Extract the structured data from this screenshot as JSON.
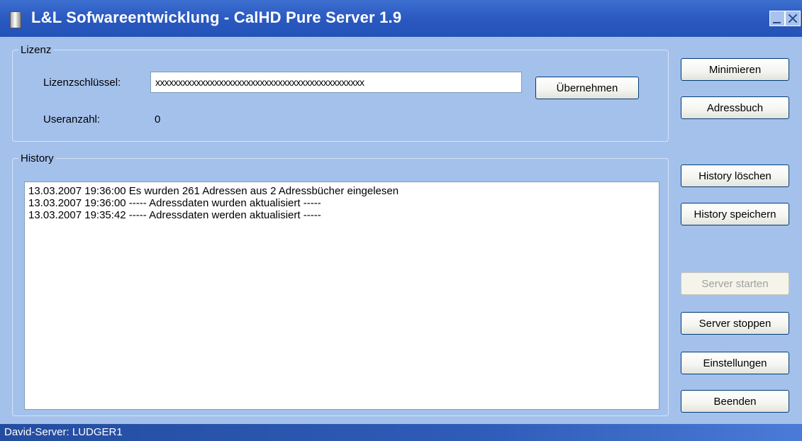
{
  "window": {
    "title": "L&L Sofwareentwicklung - CalHD Pure Server 1.9"
  },
  "lizenz": {
    "legend": "Lizenz",
    "key_label": "Lizenzschlüssel:",
    "key_value": "xxxxxxxxxxxxxxxxxxxxxxxxxxxxxxxxxxxxxxxxxxxxxx",
    "apply_button": "Übernehmen",
    "users_label": "Useranzahl:",
    "users_value": "0"
  },
  "history": {
    "legend": "History",
    "entries": [
      "13.03.2007 19:36:00 Es wurden 261 Adressen aus 2 Adressbücher eingelesen",
      "13.03.2007 19:36:00 ----- Adressdaten wurden aktualisiert -----",
      "13.03.2007 19:35:42 ----- Adressdaten werden aktualisiert -----"
    ]
  },
  "buttons": {
    "minimize": "Minimieren",
    "address_book": "Adressbuch",
    "history_clear": "History löschen",
    "history_save": "History speichern",
    "server_start": "Server starten",
    "server_stop": "Server stoppen",
    "settings": "Einstellungen",
    "exit": "Beenden"
  },
  "status": {
    "text": "David-Server: LUDGER1"
  },
  "icons": {
    "app": "server-icon",
    "minimize": "minimize-icon",
    "close": "close-icon"
  },
  "colors": {
    "title_bar": "#2a59c0",
    "window_bg": "#a4c1ec",
    "status_bar": "#2f5cb8"
  }
}
